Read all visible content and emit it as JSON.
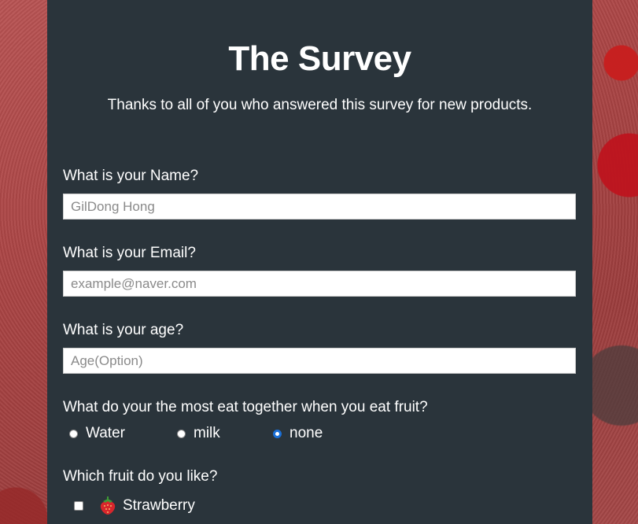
{
  "page": {
    "title": "The Survey",
    "description": "Thanks to all of you who answered this survey for new products."
  },
  "name_field": {
    "label": "What is your Name?",
    "placeholder": "GilDong Hong",
    "value": ""
  },
  "email_field": {
    "label": "What is your Email?",
    "placeholder": "example@naver.com",
    "value": ""
  },
  "age_field": {
    "label": "What is your age?",
    "placeholder": "Age(Option)",
    "value": ""
  },
  "drink_question": {
    "label": "What do your the most eat together when you eat fruit?",
    "options": [
      {
        "label": "Water",
        "checked": false
      },
      {
        "label": "milk",
        "checked": false
      },
      {
        "label": "none",
        "checked": true
      }
    ]
  },
  "fruit_question": {
    "label": "Which fruit do you like?",
    "options": [
      {
        "label": "Strawberry",
        "icon": "strawberry-icon",
        "checked": false
      }
    ]
  },
  "colors": {
    "panel": "#2a343b",
    "radio_selected": "#1a6fd6"
  }
}
